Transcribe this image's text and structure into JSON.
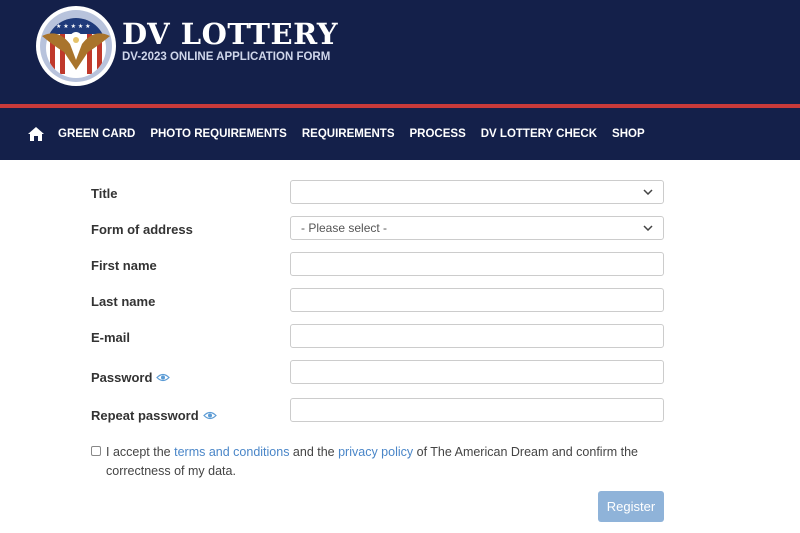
{
  "header": {
    "title": "DV LOTTERY",
    "subtitle": "DV-2023 ONLINE APPLICATION FORM",
    "logo_icon": "eagle-seal-icon"
  },
  "nav": {
    "home_icon": "home-icon",
    "items": [
      "GREEN CARD",
      "PHOTO REQUIREMENTS",
      "REQUIREMENTS",
      "PROCESS",
      "DV LOTTERY CHECK",
      "SHOP"
    ]
  },
  "form": {
    "title": {
      "label": "Title",
      "value": ""
    },
    "form_of_address": {
      "label": "Form of address",
      "value": "- Please select -"
    },
    "first_name": {
      "label": "First name",
      "value": ""
    },
    "last_name": {
      "label": "Last name",
      "value": ""
    },
    "email": {
      "label": "E-mail",
      "value": ""
    },
    "password": {
      "label": "Password",
      "value": ""
    },
    "repeat_password": {
      "label": "Repeat password",
      "value": ""
    },
    "consent": {
      "part1": "I accept the ",
      "terms_link": "terms and conditions",
      "part2": " and the ",
      "privacy_link": "privacy policy",
      "part3": " of The American Dream and confirm the correctness of my data.",
      "checked": false
    },
    "register_label": "Register"
  },
  "colors": {
    "header_bg": "#14204a",
    "stripe": "#c83a3a",
    "link": "#4a86c8",
    "button": "#8fb3d9"
  }
}
